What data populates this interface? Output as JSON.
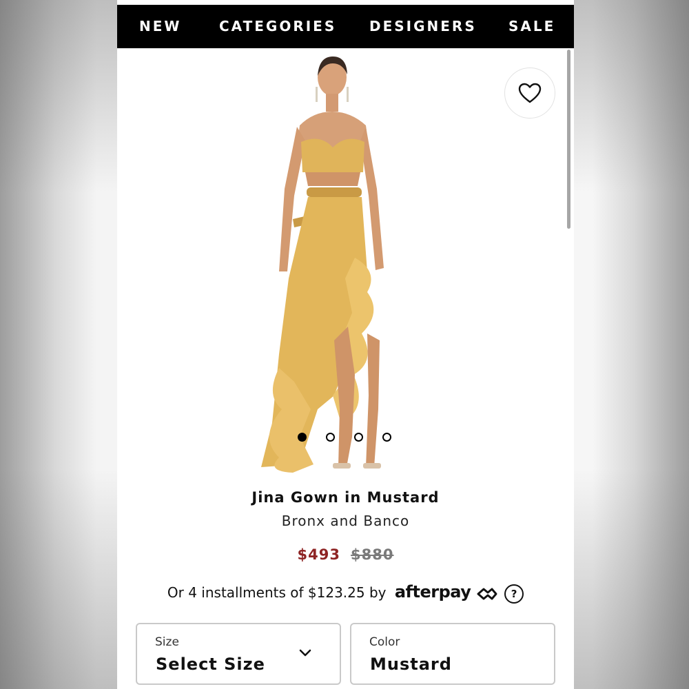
{
  "nav": {
    "items": [
      {
        "label": "NEW"
      },
      {
        "label": "CATEGORIES"
      },
      {
        "label": "DESIGNERS"
      },
      {
        "label": "SALE"
      }
    ]
  },
  "icons": {
    "wishlist": "heart-icon",
    "dropdown": "chevron-down-icon",
    "help": "question-circle-icon"
  },
  "gallery": {
    "slide_count": 4,
    "active_index": 0
  },
  "product": {
    "title": "Jina Gown in Mustard",
    "brand": "Bronx and Banco",
    "sale_price": "$493",
    "original_price": "$880",
    "dress_color": "#e2b65a"
  },
  "installments": {
    "text": "Or 4 installments of $123.25 by",
    "provider": "afterpay",
    "help_symbol": "?"
  },
  "selectors": {
    "size": {
      "label": "Size",
      "value": "Select Size"
    },
    "color": {
      "label": "Color",
      "value": "Mustard"
    }
  },
  "colors": {
    "nav_bg": "#000000",
    "sale_price": "#8e2424",
    "original_price": "#7a7a7a"
  }
}
